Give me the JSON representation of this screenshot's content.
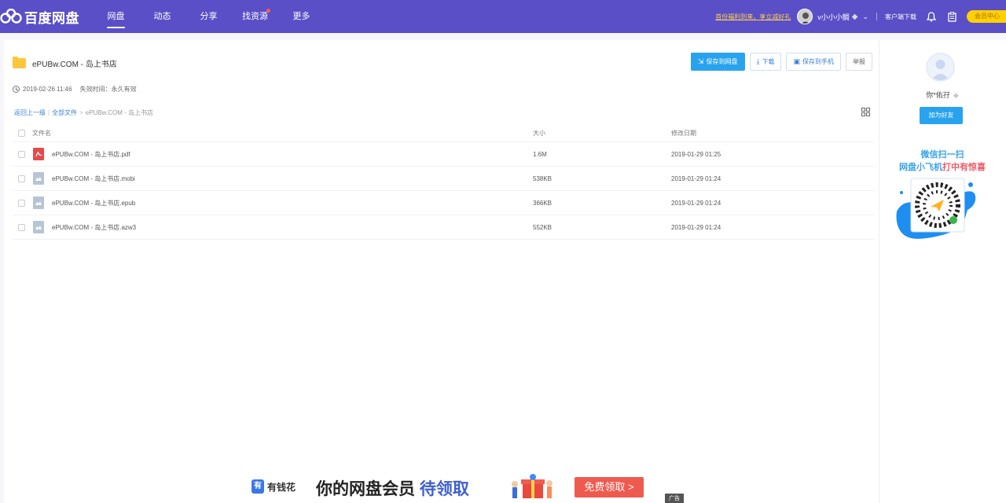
{
  "app": {
    "logo_text": "百度网盘",
    "colors": {
      "nav_bg": "#5a4fc6",
      "accent": "#2aa3ef",
      "vip": "#ffd100"
    }
  },
  "nav": {
    "items": [
      {
        "label": "网盘",
        "active": true
      },
      {
        "label": "动态"
      },
      {
        "label": "分享"
      },
      {
        "label": "找资源",
        "dot": true
      },
      {
        "label": "更多"
      }
    ]
  },
  "topbar": {
    "promo": "首份福利到来，享立减好礼",
    "username": "v小小小鲷",
    "client_download": "客户端下载",
    "vip_center": "会员中心",
    "icons": [
      "bell-icon",
      "clipboard-icon"
    ]
  },
  "share": {
    "folder_name": "ePUBw.COM - 岛上书店",
    "date": "2019-02-26 11:46",
    "expire": "失效时间：永久有效"
  },
  "actions": {
    "save": "保存到网盘",
    "download": "下载",
    "save_phone": "保存到手机",
    "report": "举报"
  },
  "breadcrumb": {
    "back": "返回上一级",
    "sep1": "|",
    "all": "全部文件",
    "sep2": ">",
    "current": "ePUBw.COM - 岛上书店"
  },
  "table": {
    "headers": {
      "name": "文件名",
      "size": "大小",
      "date": "修改日期"
    },
    "rows": [
      {
        "name": "ePUBw.COM - 岛上书店.pdf",
        "size": "1.6M",
        "date": "2019-01-29 01:25",
        "type": "pdf"
      },
      {
        "name": "ePUBw.COM - 岛上书店.mobi",
        "size": "538KB",
        "date": "2019-01-29 01:24",
        "type": "doc"
      },
      {
        "name": "ePUBw.COM - 岛上书店.epub",
        "size": "366KB",
        "date": "2019-01-29 01:24",
        "type": "doc"
      },
      {
        "name": "ePUBw.COM - 岛上书店.azw3",
        "size": "552KB",
        "date": "2019-01-29 01:24",
        "type": "doc"
      }
    ]
  },
  "sidebar": {
    "user": "你*佑孖",
    "add_friend": "加为好友",
    "scan_title": "微信扫一扫",
    "scan_sub_a": "网盘小飞机",
    "scan_sub_b": "打中有惊喜"
  },
  "ad": {
    "brand": "有钱花",
    "brand_logo": "有",
    "headline_a": "你的网盘会员 ",
    "headline_b": "待领取",
    "cta": "免费领取 >",
    "tag": "广告"
  }
}
